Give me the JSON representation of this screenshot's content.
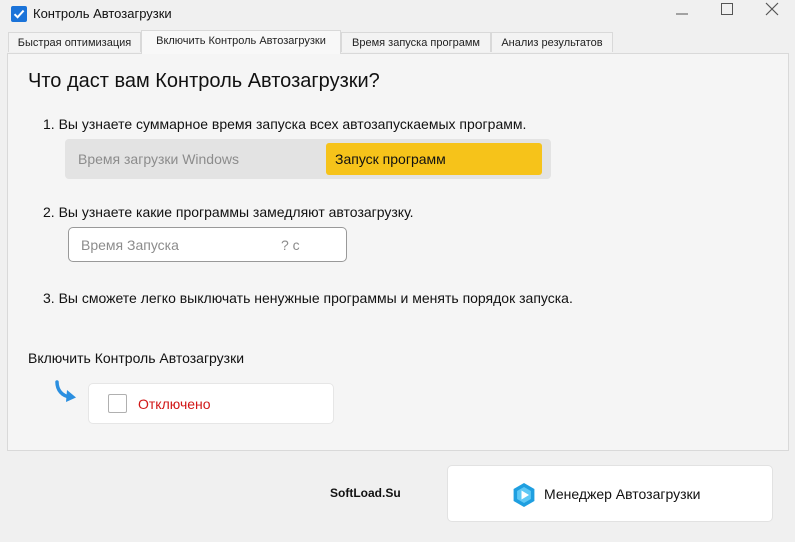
{
  "window": {
    "title": "Контроль Автозагрузки"
  },
  "tabs": [
    {
      "label": "Быстрая оптимизация"
    },
    {
      "label": "Включить Контроль Автозагрузки"
    },
    {
      "label": "Время запуска программ"
    },
    {
      "label": "Анализ результатов"
    }
  ],
  "main": {
    "heading": "Что даст вам Контроль Автозагрузки?",
    "steps": [
      "1. Вы узнаете суммарное время запуска всех автозапускаемых программ.",
      "2. Вы узнаете какие программы замедляют автозагрузку.",
      "3. Вы сможете легко выключать ненужные программы и менять порядок запуска."
    ],
    "time_bar": {
      "windows_label": "Время загрузки Windows",
      "programs_label": "Запуск программ"
    },
    "startup_field": {
      "label": "Время Запуска",
      "value": "? с"
    },
    "enable_label": "Включить Контроль Автозагрузки",
    "toggle": {
      "state_label": "Отключено",
      "checked": false
    }
  },
  "footer": {
    "watermark": "SoftLoad.Su",
    "manager_button_label": "Менеджер Автозагрузки"
  },
  "colors": {
    "accent": "#1a73d9",
    "programs_highlight": "#f6c31a",
    "disabled_text": "#d11717",
    "arrow": "#2b8fe0"
  },
  "icons": {
    "app": "checkbox-checked-icon",
    "arrow": "curved-arrow-icon",
    "manager": "startup-manager-icon"
  }
}
